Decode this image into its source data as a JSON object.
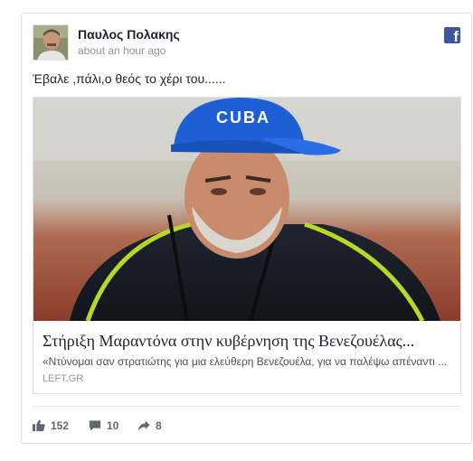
{
  "post": {
    "author": "Παυλος Πολακης",
    "timestamp": "about an hour ago",
    "text": "Έβαλε ,πάλι,ο θεός το χέρι του......"
  },
  "link": {
    "title": "Στήριξη Μαραντόνα στην κυβέρνηση της Βενεζουέλας...",
    "description": "«Ντύνομαι σαν στρατιώτης για μια ελεύθερη Βενεζουέλα, για να παλέψω απέναντι ...",
    "domain": "LEFT.GR",
    "cap_text": "CUBA"
  },
  "stats": {
    "likes": "152",
    "comments": "10",
    "shares": "8"
  },
  "colors": {
    "facebook_blue": "#3b5998",
    "cap_blue": "#1f5fd6",
    "muted_text": "#90949c"
  },
  "icons": [
    "facebook-logo-icon",
    "thumbs-up-icon",
    "comment-icon",
    "share-icon"
  ]
}
